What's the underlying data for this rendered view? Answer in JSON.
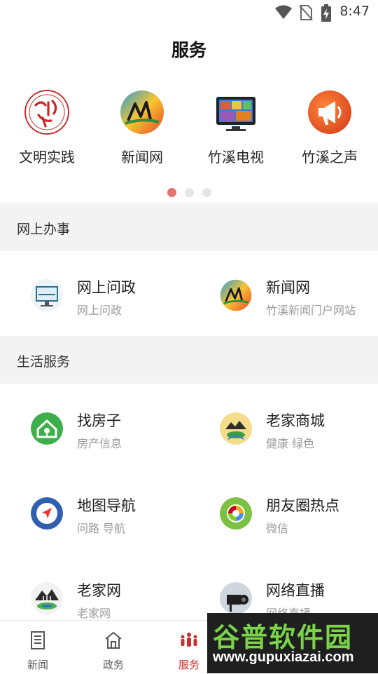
{
  "status_bar": {
    "time": "8:47",
    "icons": [
      "wifi-icon",
      "no-sim-icon",
      "battery-charging-icon"
    ]
  },
  "header": {
    "title": "服务"
  },
  "carousel": {
    "items": [
      {
        "label": "文明实践",
        "icon": "xinshidai-logo-icon"
      },
      {
        "label": "新闻网",
        "icon": "news-site-logo-icon"
      },
      {
        "label": "竹溪电视",
        "icon": "tv-icon"
      },
      {
        "label": "竹溪之声",
        "icon": "megaphone-icon"
      }
    ],
    "page_count": 3,
    "active_page": 1
  },
  "sections": [
    {
      "title": "网上办事",
      "items": [
        {
          "title": "网上问政",
          "subtitle": "网上问政",
          "icon": "monitor-icon"
        },
        {
          "title": "新闻网",
          "subtitle": "竹溪新闻门户网站",
          "icon": "news-site-logo-icon"
        }
      ]
    },
    {
      "title": "生活服务",
      "items": [
        {
          "title": "找房子",
          "subtitle": "房产信息",
          "icon": "house-icon"
        },
        {
          "title": "老家商城",
          "subtitle": "健康 绿色",
          "icon": "hometown-mall-logo-icon"
        },
        {
          "title": "地图导航",
          "subtitle": "问路 导航",
          "icon": "compass-icon"
        },
        {
          "title": "朋友圈热点",
          "subtitle": "微信",
          "icon": "moments-icon"
        },
        {
          "title": "老家网",
          "subtitle": "老家网",
          "icon": "hometown-site-logo-icon"
        },
        {
          "title": "网络直播",
          "subtitle": "网络直播",
          "icon": "live-camera-icon"
        }
      ]
    }
  ],
  "bottom_nav": {
    "items": [
      {
        "label": "新闻",
        "icon": "newspaper-icon"
      },
      {
        "label": "政务",
        "icon": "government-building-icon"
      },
      {
        "label": "服务",
        "icon": "people-icon"
      },
      {
        "label": "",
        "icon": ""
      },
      {
        "label": "",
        "icon": ""
      }
    ],
    "active_index": 2
  },
  "watermark": {
    "brand": "谷普软件园",
    "url": "www.gupuxiazai.com"
  },
  "colors": {
    "accent": "#c9302c",
    "section_bg": "#f3f3f3",
    "dot_active": "#e8736c"
  }
}
